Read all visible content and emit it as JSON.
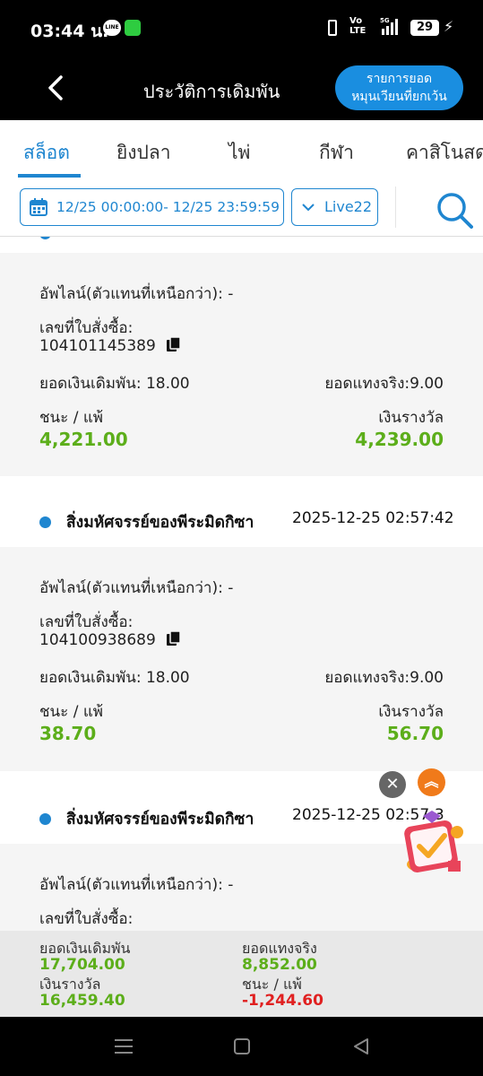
{
  "status_bar": {
    "time": "03:44 น.",
    "network": "Vo LTE",
    "signal": "5G",
    "battery": "29"
  },
  "header": {
    "title": "ประวัติการเดิมพัน",
    "turnover_line1": "รายการยอด",
    "turnover_line2": "หมุนเวียนที่ยกเว้น"
  },
  "tabs": [
    {
      "label": "สล็อต",
      "active": true
    },
    {
      "label": "ยิงปลา",
      "active": false
    },
    {
      "label": "ไพ่",
      "active": false
    },
    {
      "label": "กีฬา",
      "active": false
    },
    {
      "label": "คาสิโนสด",
      "active": false
    }
  ],
  "filters": {
    "date_range": "12/25 00:00:00- 12/25 23:59:59",
    "game_provider": "Live22"
  },
  "labels": {
    "upline": "อัพไลน์(ตัวแทนที่เหนือกว่า): -",
    "order_no": "เลขที่ใบสั่งซื้อ:",
    "win_loss": "ชนะ / แพ้",
    "prize": "เงินรางวัล"
  },
  "records": [
    {
      "game": "",
      "datetime": "",
      "order_id": "104101145389",
      "bet_amount": "ยอดเงินเดิมพัน: 18.00",
      "valid_bet": "ยอดแทงจริง:9.00",
      "win_loss": "4,221.00",
      "prize": "4,239.00"
    },
    {
      "game": "สิ่งมหัศจรรย์ของพีระมิดกิซา",
      "datetime": "2025-12-25 02:57:42",
      "order_id": "104100938689",
      "bet_amount": "ยอดเงินเดิมพัน: 18.00",
      "valid_bet": "ยอดแทงจริง:9.00",
      "win_loss": "38.70",
      "prize": "56.70"
    },
    {
      "game": "สิ่งมหัศจรรย์ของพีระมิดกิซา",
      "datetime": "2025-12-25 02:57:3",
      "order_id": "",
      "bet_amount": "",
      "valid_bet": "",
      "win_loss": "",
      "prize": ""
    }
  ],
  "summary": {
    "bet_label": "ยอดเงินเดิมพัน",
    "bet_value": "17,704.00",
    "valid_label": "ยอดแทงจริง",
    "valid_value": "8,852.00",
    "prize_label": "เงินรางวัล",
    "prize_value": "16,459.40",
    "winloss_label": "ชนะ / แพ้",
    "winloss_value": "-1,244.60"
  },
  "colors": {
    "accent": "#1f86d0",
    "positive": "#5cae1a",
    "negative": "#e02020"
  }
}
